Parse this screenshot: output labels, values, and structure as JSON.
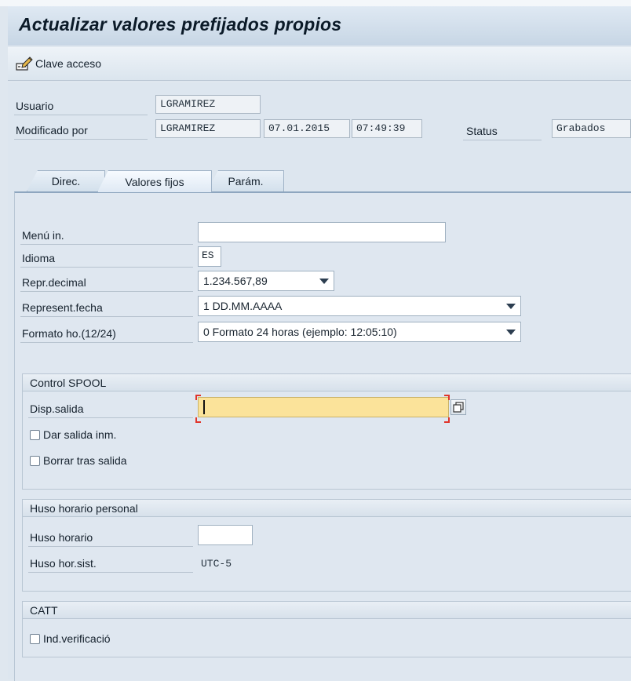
{
  "title": "Actualizar valores prefijados propios",
  "toolbar": {
    "password_label": "Clave acceso",
    "password_icon": "edit-key-icon"
  },
  "header": {
    "user_label": "Usuario",
    "user_value": "LGRAMIREZ",
    "modified_by_label": "Modificado por",
    "modified_by_value": "LGRAMIREZ",
    "modified_date": "07.01.2015",
    "modified_time": "07:49:39",
    "status_label": "Status",
    "status_value": "Grabados"
  },
  "tabs": [
    {
      "label": "Direc.",
      "active": false
    },
    {
      "label": "Valores fijos",
      "active": true
    },
    {
      "label": "Parám.",
      "active": false
    }
  ],
  "defaults": {
    "start_menu_label": "Menú in.",
    "start_menu_value": "",
    "language_label": "Idioma",
    "language_value": "ES",
    "decimal_label": "Repr.decimal",
    "decimal_value": "1.234.567,89",
    "date_label": "Represent.fecha",
    "date_value": "1 DD.MM.AAAA",
    "time_format_label": "Formato ho.(12/24)",
    "time_format_value": "0 Formato 24 horas (ejemplo: 12:05:10)"
  },
  "spool": {
    "title": "Control SPOOL",
    "output_device_label": "Disp.salida",
    "output_device_value": "",
    "print_immediately_label": "Dar salida inm.",
    "print_immediately_checked": false,
    "delete_after_output_label": "Borrar tras salida",
    "delete_after_output_checked": false
  },
  "timezone": {
    "title": "Huso horario personal",
    "personal_label": "Huso horario",
    "personal_value": "",
    "system_label": "Huso hor.sist.",
    "system_value": "UTC-5"
  },
  "catt": {
    "title": "CATT",
    "check_label": "Ind.verificació",
    "check_checked": false
  },
  "colors": {
    "focus_field": "#fbe39a",
    "required_bracket": "#e0352b",
    "background": "#dfe7ef"
  }
}
